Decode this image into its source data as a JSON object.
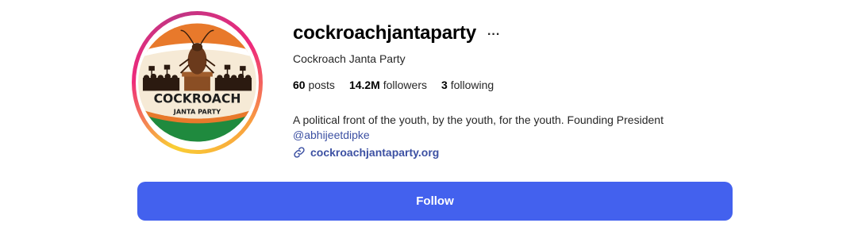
{
  "profile": {
    "username": "cockroachjantaparty",
    "more_icon": "...",
    "full_name": "Cockroach Janta Party",
    "avatar_logo": {
      "line1": "COCKROACH",
      "line2": "JANTA PARTY"
    },
    "colors": {
      "follow_button": "#4361ee",
      "link": "#3d51a3",
      "saffron": "#e8792b",
      "green": "#1f8a3e"
    }
  },
  "stats": {
    "posts_count": "60",
    "posts_label": "posts",
    "followers_count": "14.2M",
    "followers_label": "followers",
    "following_count": "3",
    "following_label": "following"
  },
  "bio": {
    "text": "A political front of the youth, by the youth, for the youth. Founding President",
    "mention": "@abhijeetdipke"
  },
  "website": {
    "icon": "link-icon",
    "label": "cockroachjantaparty.org"
  },
  "actions": {
    "follow_label": "Follow"
  }
}
